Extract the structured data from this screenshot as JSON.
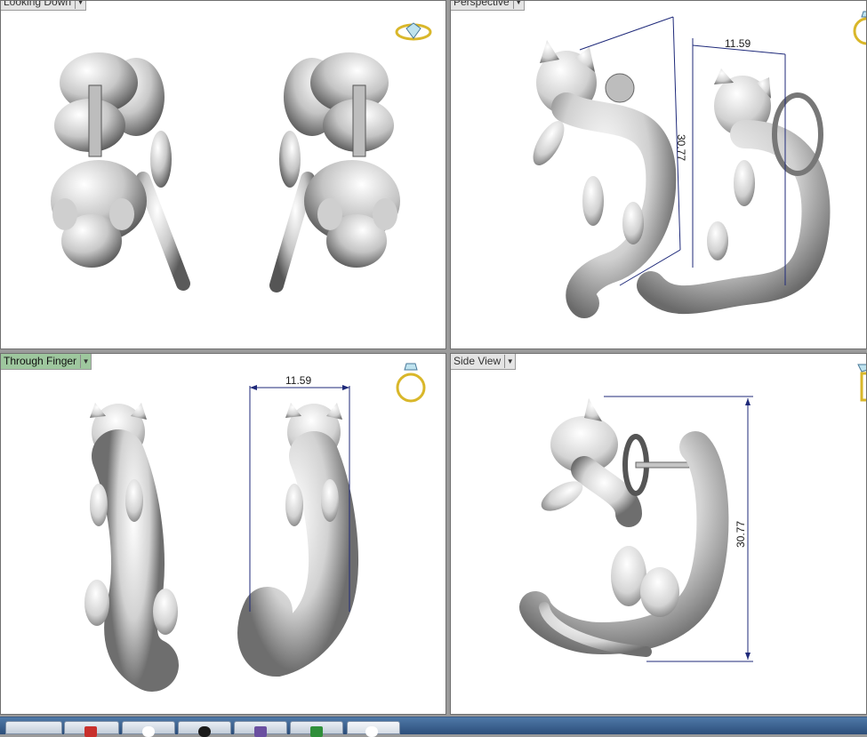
{
  "viewports": {
    "top_left": {
      "label": "Looking Down"
    },
    "top_right": {
      "label": "Perspective",
      "dimension": "11.59",
      "dimension_vertical": "30.77"
    },
    "bottom_left": {
      "label": "Through Finger",
      "active": true,
      "dimension": "11.59"
    },
    "bottom_right": {
      "label": "Side View",
      "dimension": "30.77"
    }
  },
  "icons": {
    "dropdown": "chevron-down-icon",
    "gem_ring": "gem-ring-icon",
    "ring": "ring-icon"
  },
  "colors": {
    "viewport_bg": "#ffffff",
    "active_label": "#9ec79e",
    "dimension_line": "#1f2a7a",
    "gizmo_gold": "#d9b72a",
    "taskbar": "#2c4e7a"
  }
}
